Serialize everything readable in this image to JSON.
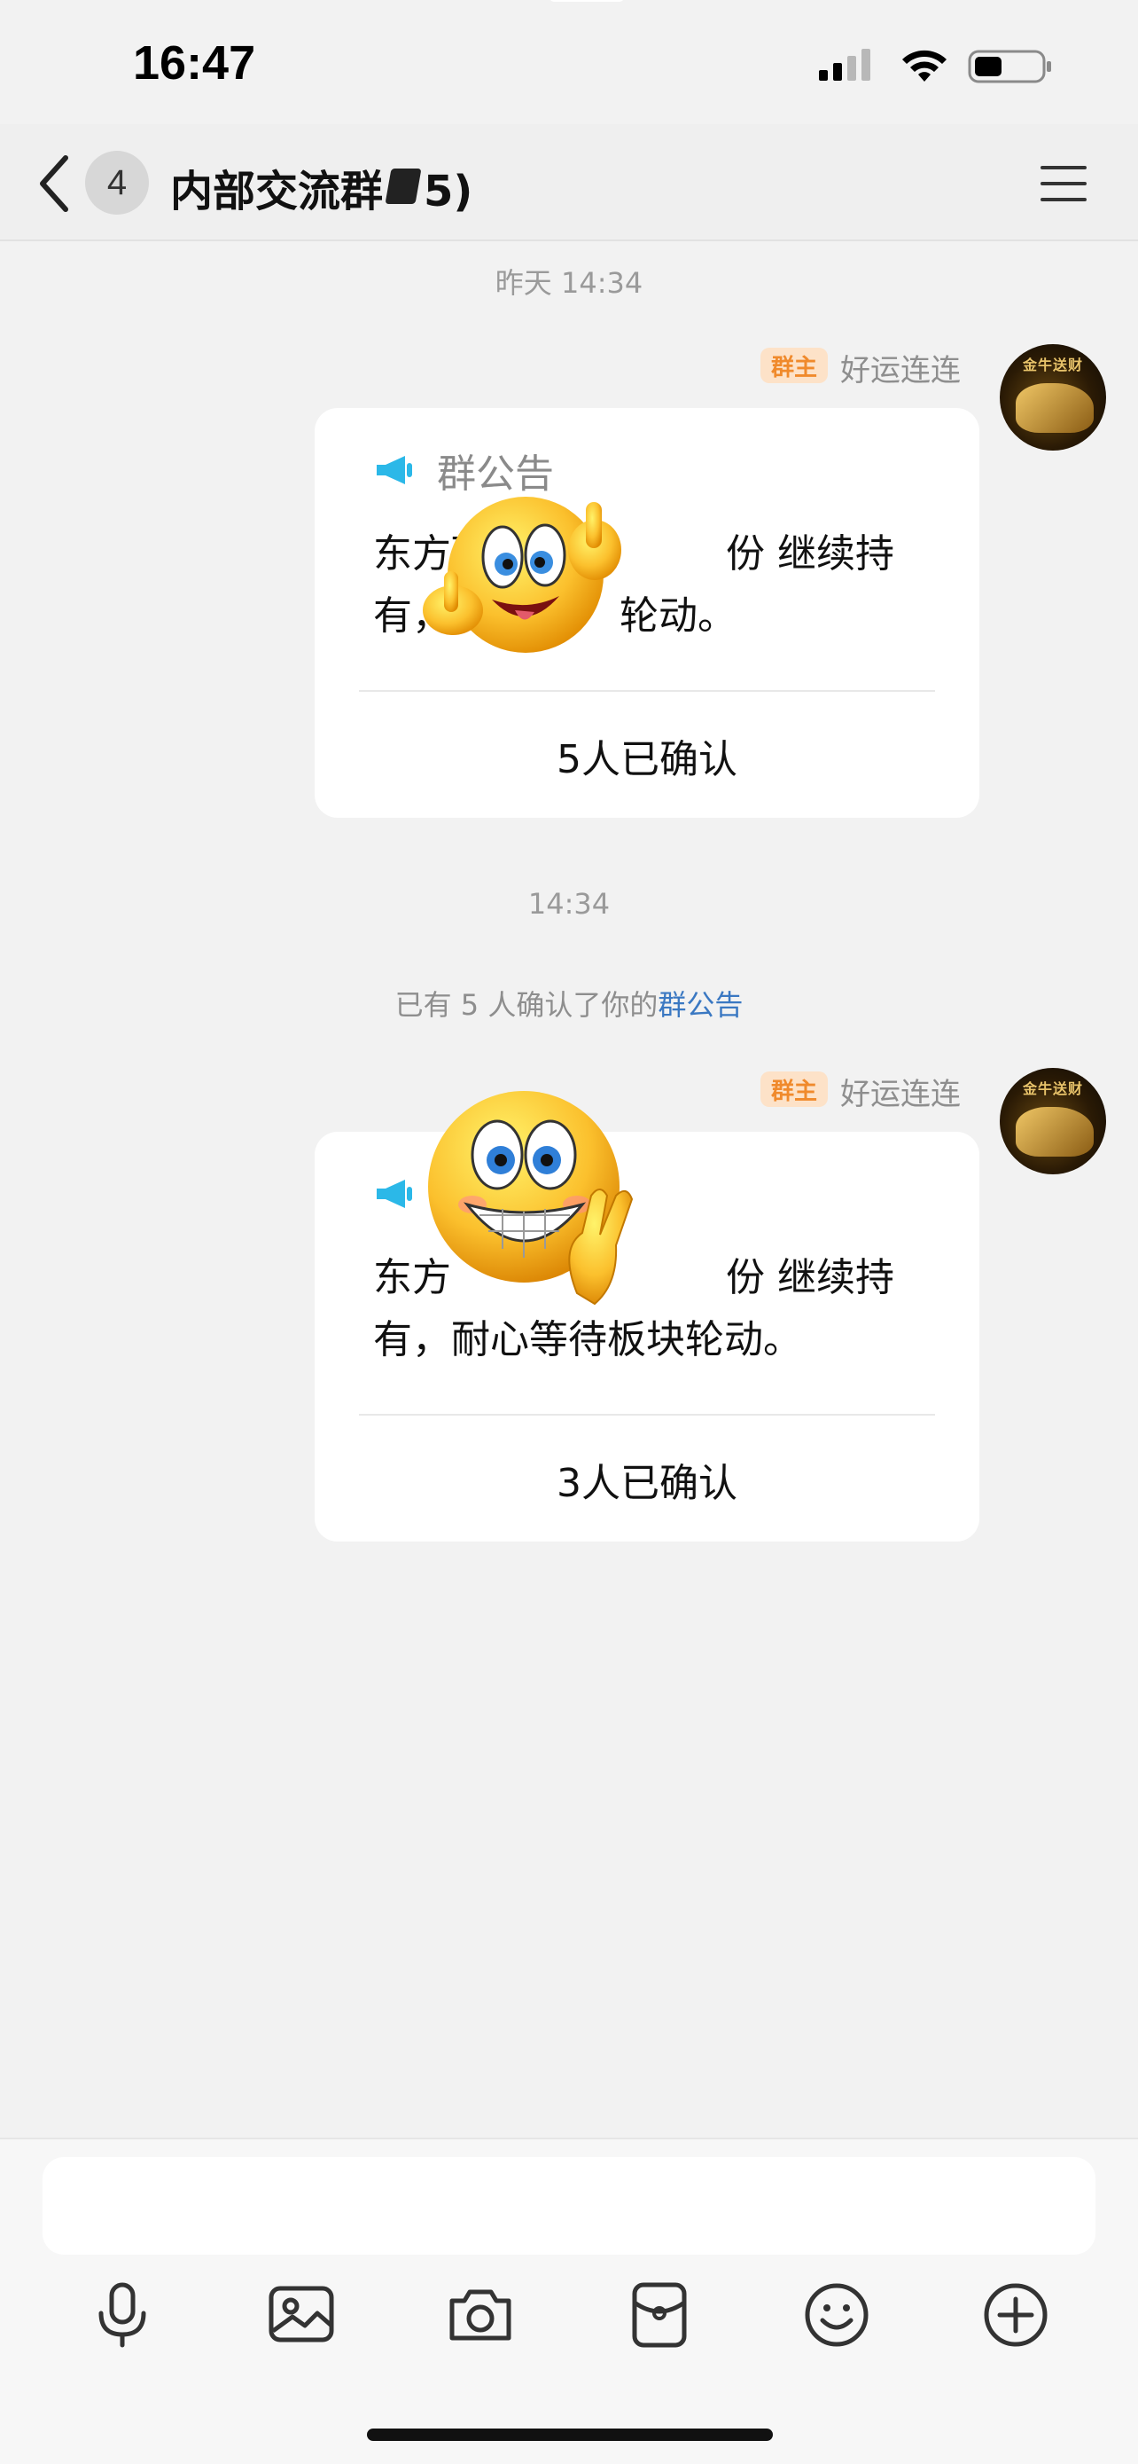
{
  "status_bar": {
    "time": "16:47"
  },
  "header": {
    "unread_count": "4",
    "title": "内部交流群",
    "title_suffix": "5)"
  },
  "messages": [
    {
      "timestamp": "昨天 14:34",
      "owner_tag": "群主",
      "sender": "好运连连",
      "avatar_text": "金牛送财",
      "card_title": "群公告",
      "card_body_line1": "东方环",
      "card_body_line1_end": "份 继续持",
      "card_body_line2": "有，",
      "card_body_line2_end": "轮动。",
      "confirm": "5人已确认"
    },
    {
      "timestamp": "14:34",
      "owner_tag": "群主",
      "sender": "好运连连",
      "avatar_text": "金牛送财",
      "card_body_line1": "东方",
      "card_body_line1_end": "份 继续持",
      "card_body_line2": "有，耐心等待板块轮动。",
      "confirm": "3人已确认"
    }
  ],
  "system_message": {
    "prefix": "已有 5 人确认了你的",
    "link": "群公告"
  },
  "toolbar": [
    {
      "icon": "microphone-icon"
    },
    {
      "icon": "image-icon"
    },
    {
      "icon": "camera-icon"
    },
    {
      "icon": "red-packet-icon"
    },
    {
      "icon": "emoji-icon"
    },
    {
      "icon": "plus-icon"
    }
  ],
  "colors": {
    "background": "#f2f2f2",
    "owner_tag_bg": "#fde2c8",
    "owner_tag_text": "#f08a2c",
    "link": "#3a78c2",
    "megaphone": "#2bb8e8"
  }
}
